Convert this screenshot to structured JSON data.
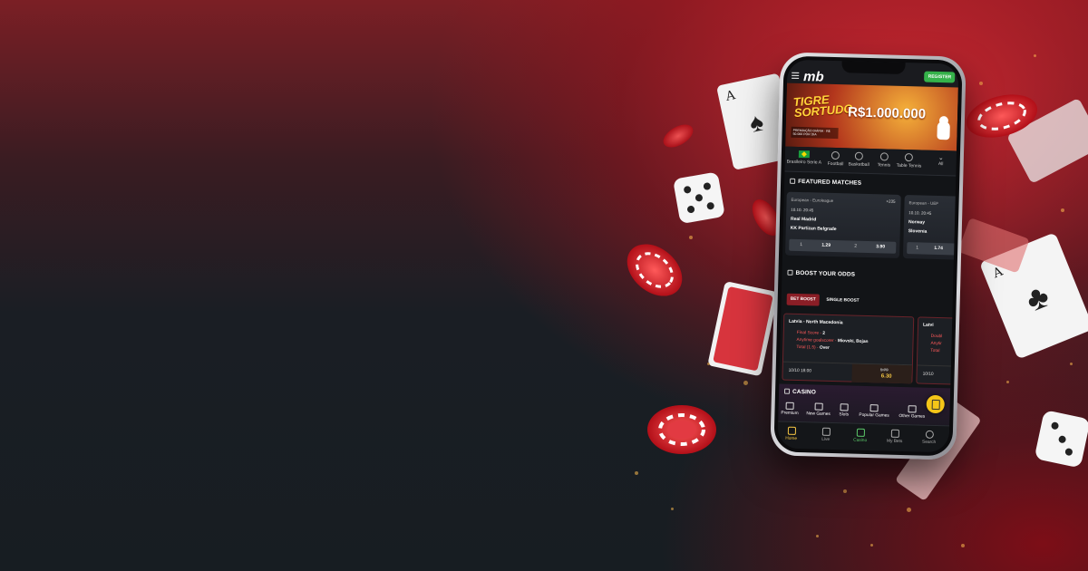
{
  "app": {
    "logo_text": "mb",
    "register_label": "REGISTER"
  },
  "banner": {
    "title_line1": "TIGRE",
    "title_line2": "SORTUDO",
    "amount": "R$1.000.000",
    "subtext": "PREMIAÇÃO DIÁRIA · R$ 50.000 POR DIA"
  },
  "sports": [
    {
      "label": "Brasileiro Serie A",
      "icon": "brazil-flag-icon"
    },
    {
      "label": "Football",
      "icon": "football-icon"
    },
    {
      "label": "Basketball",
      "icon": "basketball-icon"
    },
    {
      "label": "Tennis",
      "icon": "tennis-icon"
    },
    {
      "label": "Table Tennis",
      "icon": "table-tennis-icon"
    },
    {
      "label": "All",
      "icon": "chevron-down-icon"
    }
  ],
  "featured": {
    "title": "FEATURED MATCHES",
    "matches": [
      {
        "league": "European - Euroleague",
        "more": "+235",
        "time": "10.10. 20:45",
        "home": "Real Madrid",
        "away": "KK Partizan Belgrade",
        "odd1_label": "1",
        "odd1": "1.29",
        "odd2_label": "2",
        "odd2": "3.90"
      },
      {
        "league": "European - UEF",
        "time": "10.10. 20:45",
        "home": "Norway",
        "away": "Slovenia",
        "odd1_label": "1",
        "odd1": "1.74"
      }
    ]
  },
  "boost": {
    "title": "BOOST YOUR ODDS",
    "tabs": [
      "BET BOOST",
      "SINGLE BOOST"
    ],
    "cards": [
      {
        "match": "Latvia - North Macedonia",
        "line1_label": "Final Score",
        "line1_value": "2",
        "line2_label": "Anytime goalscorer",
        "line2_value": "Miovski, Bojan",
        "line3_label": "Total (1.5)",
        "line3_value": "Over",
        "date": "10/10 18:00",
        "old_odd": "5.79",
        "new_odd": "6.30"
      },
      {
        "match": "Latvi",
        "line1_label": "Doubl",
        "line2_label": "Anytir",
        "line3_label": "Total",
        "date": "10/10"
      }
    ]
  },
  "casino": {
    "title": "CASINO",
    "items": [
      "Premium",
      "New Games",
      "Slots",
      "Popular Games",
      "Other Games"
    ]
  },
  "nav": [
    "Home",
    "Live",
    "Casino",
    "My Bets",
    "Search"
  ]
}
